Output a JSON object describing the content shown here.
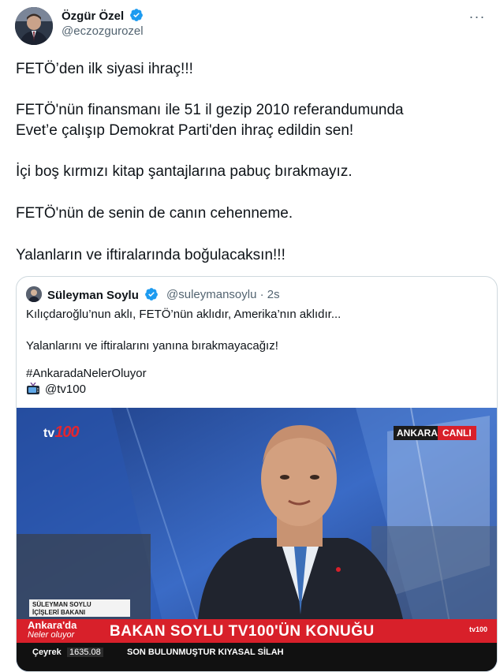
{
  "author": {
    "name": "Özgür Özel",
    "handle": "@eczozgurozel",
    "more": "···"
  },
  "tweet": {
    "line1": "FETÖ’den ilk siyasi ihraç!!!",
    "line2a": "FETÖ'nün finansmanı ile 51 il gezip 2010 referandumunda",
    "line2b": "Evet’e çalışıp Demokrat Parti'den ihraç edildin sen!",
    "line3": "İçi boş kırmızı kitap şantajlarına pabuç bırakmayız.",
    "line4": "FETÖ'nün de senin de canın cehenneme.",
    "line5": "Yalanların ve iftiralarında boğulacaksın!!!"
  },
  "quote": {
    "name": "Süleyman Soylu",
    "handle": "@suleymansoylu",
    "time": "2s",
    "line1": "Kılıçdaroğlu’nun aklı, FETÖ’nün aklıdır, Amerika’nın aklıdır...",
    "line2": "Yalanlarını ve iftiralarını yanına bırakmayacağız!",
    "hashtag": "#AnkaradaNelerOluyor",
    "mention": "@tv100"
  },
  "video": {
    "logo_tv": "tv",
    "logo_num": "100",
    "badge_city": "ANKARA",
    "badge_live": "CANLI",
    "strap_name": "SÜLEYMAN SOYLU",
    "strap_title": "İÇİŞLERİ BAKANI",
    "red_left_1": "Ankara'da",
    "red_left_2": "Neler oluyor",
    "headline": "BAKAN SOYLU TV100'ÜN KONUĞU",
    "red_logo": "tv100",
    "ticker_label": "Çeyrek",
    "ticker_value": "1635.08",
    "ticker_text": "SON   BULUNMUŞTUR   KIYASAL SİLAH"
  },
  "colors": {
    "verified": "#1d9bf0",
    "accent_red": "#d8202a",
    "text_primary": "#0f1419",
    "text_secondary": "#536471"
  }
}
